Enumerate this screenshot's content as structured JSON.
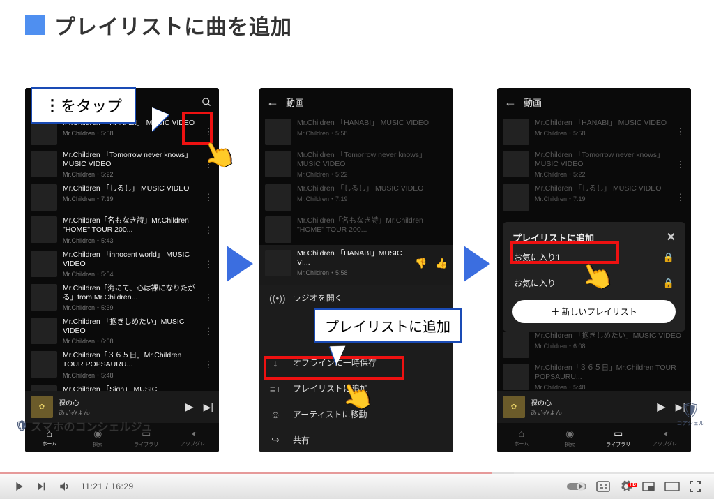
{
  "slide": {
    "title": "プレイリストに曲を追加"
  },
  "callouts": {
    "c1_prefix": "⋮",
    "c1_text": " をタップ",
    "c2_text": "プレイリストに追加"
  },
  "phone_common": {
    "topbar_title": "動画",
    "mini_player": {
      "title": "裸の心",
      "artist": "あいみょん"
    },
    "nav": {
      "home": "ホーム",
      "explore": "探索",
      "library": "ライブラリ",
      "upgrade": "アップグレ..."
    }
  },
  "songs": [
    {
      "title": "Mr.Children 「HANABI」 MUSIC VIDEO",
      "artist": "Mr.Children・5:58"
    },
    {
      "title": "Mr.Children 「Tomorrow never knows」 MUSIC VIDEO",
      "artist": "Mr.Children・5:22"
    },
    {
      "title": "Mr.Children 「しるし」 MUSIC VIDEO",
      "artist": "Mr.Children・7:19"
    },
    {
      "title": "Mr.Children「名もなき詩」Mr.Children \"HOME\" TOUR 200...",
      "artist": "Mr.Children・5:43"
    },
    {
      "title": "Mr.Children 「innocent world」 MUSIC VIDEO",
      "artist": "Mr.Children・5:54"
    },
    {
      "title": "Mr.Children「海にて、心は裸になりたがる」from Mr.Children...",
      "artist": "Mr.Children・5:39"
    },
    {
      "title": "Mr.Children 「抱きしめたい」MUSIC VIDEO",
      "artist": "Mr.Children・6:08"
    },
    {
      "title": "Mr.Children「３６５日」Mr.Children TOUR POPSAURU...",
      "artist": "Mr.Children・5:48"
    },
    {
      "title": "Mr.Children 「Sign」 MUSIC",
      "artist": ""
    }
  ],
  "phone2": {
    "selected": {
      "title": "Mr.Children 「HANABI」MUSIC VI...",
      "artist": "Mr.Children・5:58"
    },
    "menu": {
      "radio": "ラジオを開く",
      "save_offline": "オフラインに一時保存",
      "add_playlist": "プレイリストに追加",
      "move_artist": "アーティストに移動",
      "share": "共有"
    }
  },
  "phone3": {
    "dialog_title": "プレイリストに追加",
    "playlists": [
      "お気に入り1",
      "お気に入り"
    ],
    "new_btn": "＋ 新しいプレイリスト"
  },
  "footer": {
    "channel": "スマホのコンシェルジュ",
    "corner": "コアシェル"
  },
  "player": {
    "current": "11:21",
    "total": "16:29"
  }
}
